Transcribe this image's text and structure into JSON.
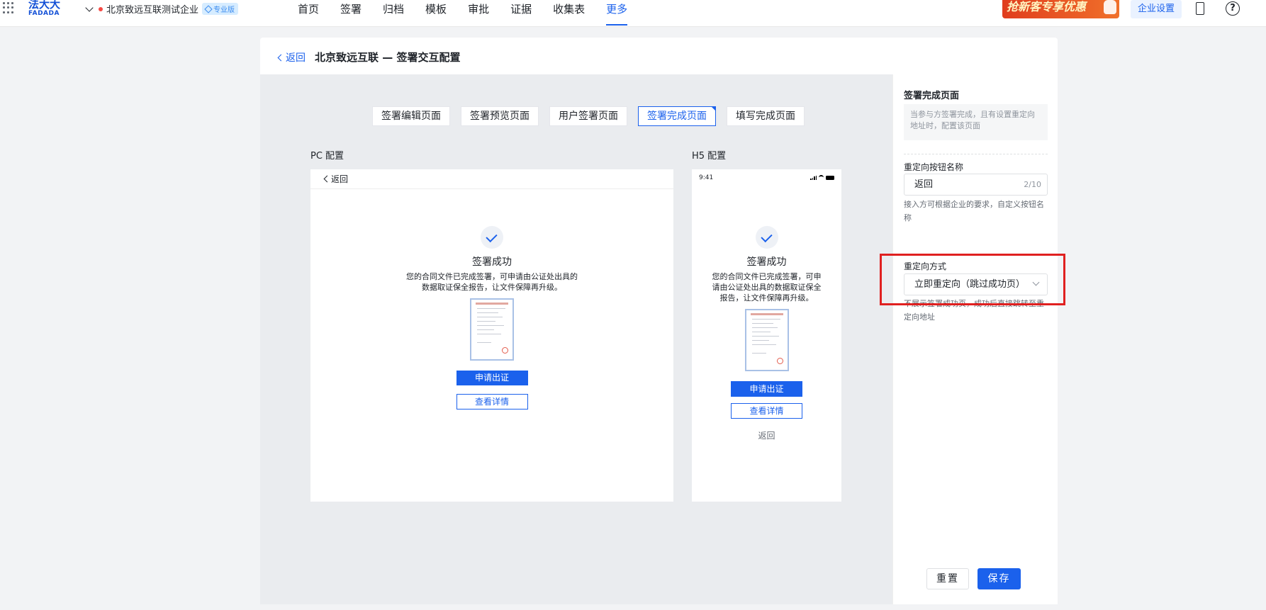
{
  "topbar": {
    "logo_line1": "法大大",
    "logo_line2": "FADADA",
    "org_name": "北京致远互联测试企业",
    "edition_badge": "专业版",
    "nav": [
      {
        "label": "首页",
        "active": false
      },
      {
        "label": "签署",
        "active": false
      },
      {
        "label": "归档",
        "active": false
      },
      {
        "label": "模板",
        "active": false
      },
      {
        "label": "审批",
        "active": false
      },
      {
        "label": "证据",
        "active": false
      },
      {
        "label": "收集表",
        "active": false
      },
      {
        "label": "更多",
        "active": true
      }
    ],
    "promo_text": "抢新客专享优惠",
    "enterprise_settings": "企业设置",
    "help_symbol": "?"
  },
  "page": {
    "back_label": "返回",
    "title": "北京致远互联 — 签署交互配置"
  },
  "tabs": [
    {
      "label": "签署编辑页面",
      "active": false
    },
    {
      "label": "签署预览页面",
      "active": false
    },
    {
      "label": "用户签署页面",
      "active": false
    },
    {
      "label": "签署完成页面",
      "active": true
    },
    {
      "label": "填写完成页面",
      "active": false
    }
  ],
  "pc_preview": {
    "section_label": "PC 配置",
    "back_label": "返回",
    "success_title": "签署成功",
    "success_desc_line1": "您的合同文件已完成签署，可申请由公证处出具的",
    "success_desc_line2": "数据取证保全报告，让文件保障再升级。",
    "apply_button": "申请出证",
    "details_button": "查看详情"
  },
  "h5_preview": {
    "section_label": "H5 配置",
    "time": "9:41",
    "success_title": "签署成功",
    "success_desc_line1": "您的合同文件已完成签署，可申",
    "success_desc_line2": "请由公证处出具的数据取证保全",
    "success_desc_line3": "报告，让文件保障再升级。",
    "apply_button": "申请出证",
    "details_button": "查看详情",
    "back_label": "返回"
  },
  "config": {
    "title": "签署完成页面",
    "tip": "当参与方签署完成，且有设置重定向地址时，配置该页面",
    "redirect_button_label": "重定向按钮名称",
    "redirect_button_value": "返回",
    "redirect_button_count": "2/10",
    "redirect_button_help": "接入方可根据企业的要求，自定义按钮名称",
    "redirect_mode_label": "重定向方式",
    "redirect_mode_value": "立即重定向（跳过成功页）",
    "redirect_mode_help": "不展示签署成功页，成功后直接跳转至重定向地址",
    "reset_button": "重置",
    "save_button": "保存"
  },
  "colors": {
    "primary": "#1b61ec",
    "highlight_box": "#e02020",
    "promo": "#e03d1e"
  }
}
